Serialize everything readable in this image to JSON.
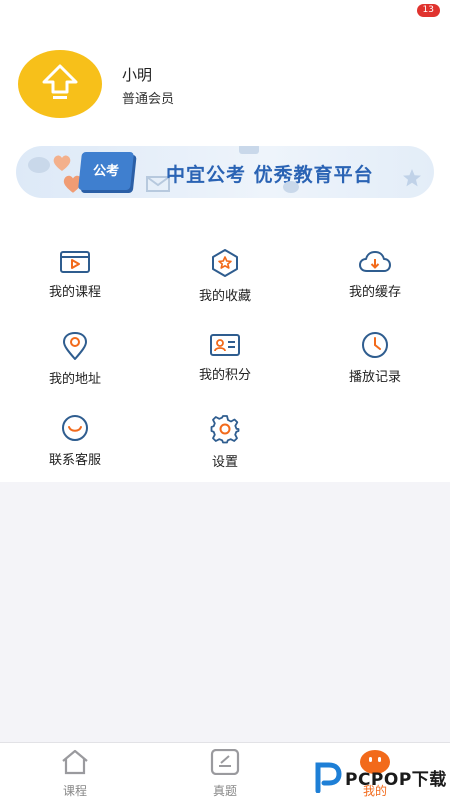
{
  "status": {
    "badge": "13"
  },
  "profile": {
    "name": "小明",
    "level": "普通会员"
  },
  "banner": {
    "tag": "公考",
    "slogan": "中宜公考 优秀教育平台"
  },
  "menu": {
    "courses": "我的课程",
    "favorites": "我的收藏",
    "cache": "我的缓存",
    "address": "我的地址",
    "points": "我的积分",
    "history": "播放记录",
    "service": "联系客服",
    "settings": "设置"
  },
  "tabs": {
    "courses": "课程",
    "questions": "真题",
    "mine": "我的"
  },
  "colors": {
    "accent": "#f26a1b",
    "icon_blue": "#2f5d8f",
    "avatar": "#f7c01a",
    "banner_blue": "#2a63b4"
  }
}
